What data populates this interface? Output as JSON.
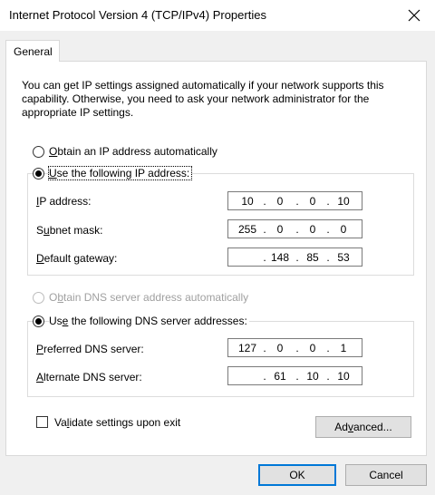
{
  "window": {
    "title": "Internet Protocol Version 4 (TCP/IPv4) Properties",
    "close_icon": "close-icon"
  },
  "tabs": [
    {
      "label": "General"
    }
  ],
  "description": "You can get IP settings assigned automatically if your network supports this capability. Otherwise, you need to ask your network administrator for the appropriate IP settings.",
  "ip_section": {
    "auto": {
      "pre": "",
      "ul": "O",
      "post": "btain an IP address automatically",
      "checked": false
    },
    "manual": {
      "pre": "",
      "ul": "U",
      "post": "se the following IP address:",
      "checked": true
    },
    "fields": [
      {
        "pre": "",
        "ul": "I",
        "post": "P address:",
        "octets": [
          "10",
          "0",
          "0",
          "10"
        ]
      },
      {
        "pre": "S",
        "ul": "u",
        "post": "bnet mask:",
        "octets": [
          "255",
          "0",
          "0",
          "0"
        ]
      },
      {
        "pre": "",
        "ul": "D",
        "post": "efault gateway:",
        "octets": [
          "",
          "148",
          "85",
          "53"
        ]
      }
    ]
  },
  "dns_section": {
    "auto": {
      "pre": "O",
      "ul": "b",
      "post": "tain DNS server address automatically",
      "disabled": true
    },
    "manual": {
      "pre": "Us",
      "ul": "e",
      "post": " the following DNS server addresses:",
      "checked": true
    },
    "fields": [
      {
        "pre": "",
        "ul": "P",
        "post": "referred DNS server:",
        "octets": [
          "127",
          "0",
          "0",
          "1"
        ]
      },
      {
        "pre": "",
        "ul": "A",
        "post": "lternate DNS server:",
        "octets": [
          "",
          "61",
          "10",
          "10"
        ]
      }
    ]
  },
  "validate": {
    "pre": "Va",
    "ul": "l",
    "post": "idate settings upon exit",
    "checked": false
  },
  "buttons": {
    "advanced": {
      "pre": "Ad",
      "ul": "v",
      "post": "anced..."
    },
    "ok": "OK",
    "cancel": "Cancel"
  },
  "colors": {
    "accent": "#0078d7",
    "window_bg": "#f0f0f0",
    "panel_bg": "#ffffff"
  }
}
